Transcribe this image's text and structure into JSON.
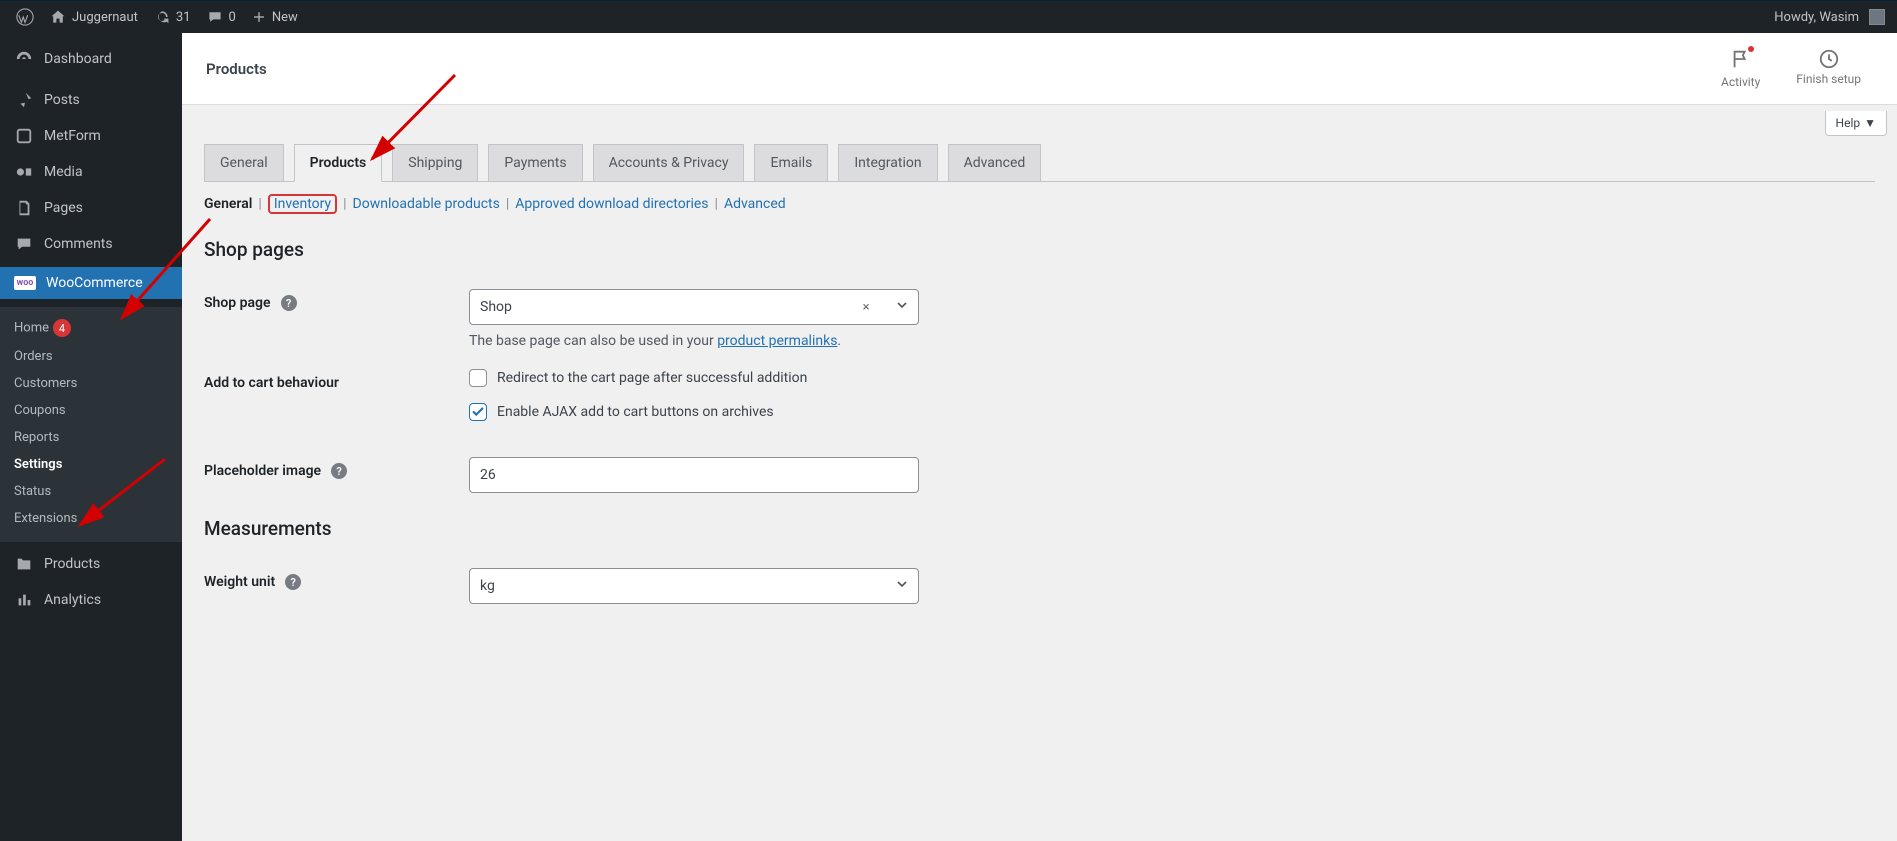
{
  "adminbar": {
    "site": "Juggernaut",
    "updates": "31",
    "comments": "0",
    "new": "New",
    "howdy_prefix": "Howdy,",
    "howdy_name": "Wasim"
  },
  "sidebar": {
    "dashboard": "Dashboard",
    "posts": "Posts",
    "metform": "MetForm",
    "media": "Media",
    "pages": "Pages",
    "comments": "Comments",
    "woo": "WooCommerce",
    "sub": {
      "home": "Home",
      "home_badge": "4",
      "orders": "Orders",
      "customers": "Customers",
      "coupons": "Coupons",
      "reports": "Reports",
      "settings": "Settings",
      "status": "Status",
      "extensions": "Extensions"
    },
    "products": "Products",
    "analytics": "Analytics"
  },
  "topbar": {
    "title": "Products",
    "activity": "Activity",
    "finish": "Finish setup",
    "help": "Help"
  },
  "tabs": [
    "General",
    "Products",
    "Shipping",
    "Payments",
    "Accounts & Privacy",
    "Emails",
    "Integration",
    "Advanced"
  ],
  "active_tab": 1,
  "subtabs": [
    "General",
    "Inventory",
    "Downloadable products",
    "Approved download directories",
    "Advanced"
  ],
  "subtab_current": 0,
  "subtab_highlight": 1,
  "section": {
    "shop_pages": "Shop pages",
    "measurements": "Measurements"
  },
  "form": {
    "shop_page_label": "Shop page",
    "shop_page_value": "Shop",
    "shop_page_desc_pre": "The base page can also be used in your ",
    "shop_page_desc_link": "product permalinks",
    "shop_page_desc_post": ".",
    "add_to_cart_label": "Add to cart behaviour",
    "redirect_label": "Redirect to the cart page after successful addition",
    "ajax_label": "Enable AJAX add to cart buttons on archives",
    "placeholder_label": "Placeholder image",
    "placeholder_value": "26",
    "weight_label": "Weight unit",
    "weight_value": "kg"
  }
}
